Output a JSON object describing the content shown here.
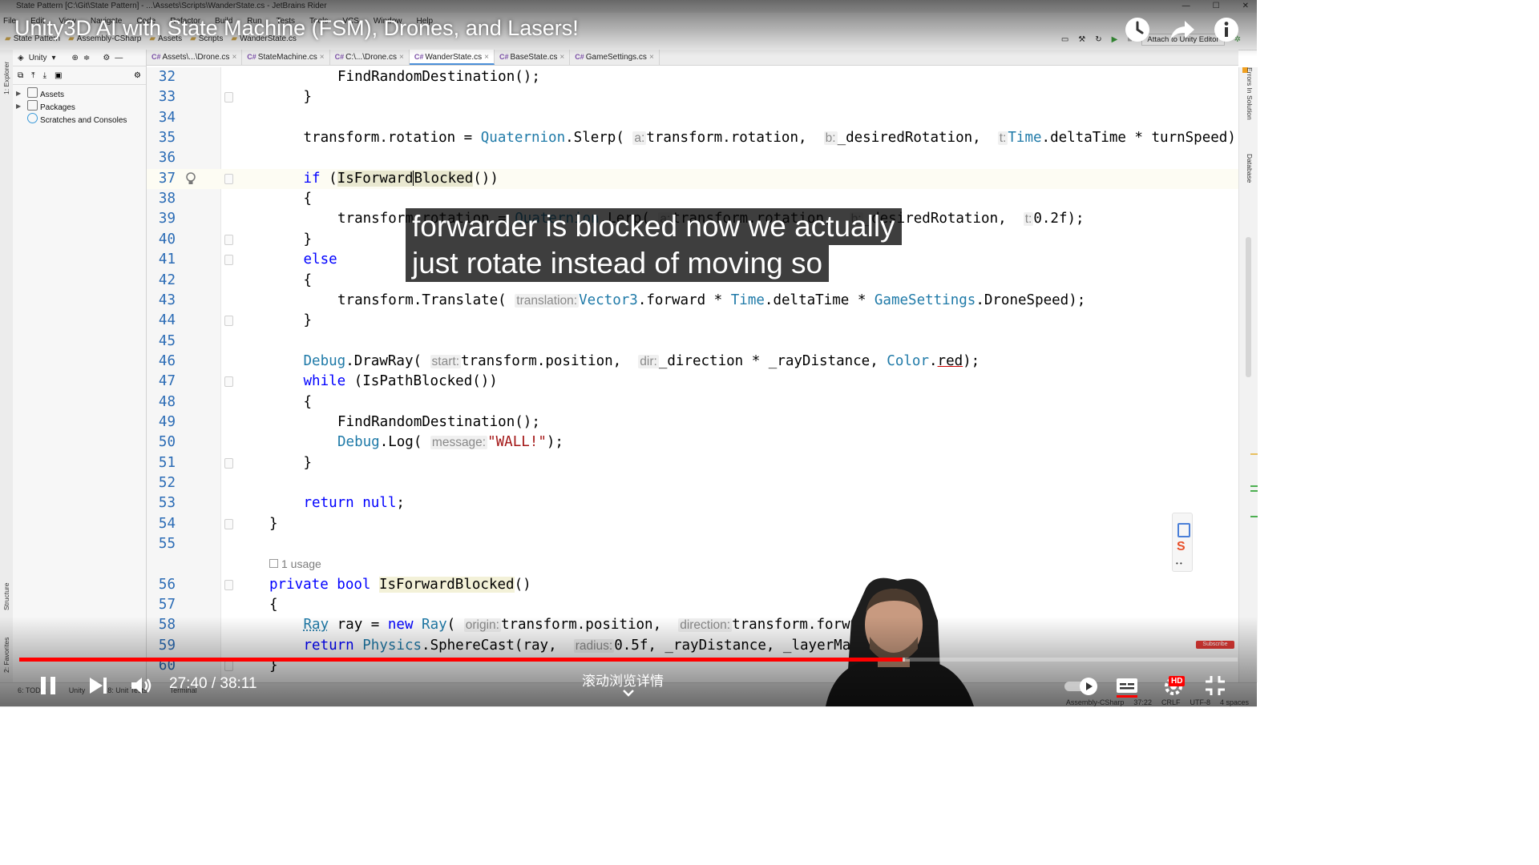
{
  "window": {
    "title": "State Pattern [C:\\Git\\State Pattern] - ...\\Assets\\Scripts\\WanderState.cs - JetBrains Rider"
  },
  "menu": [
    "File",
    "Edit",
    "View",
    "Navigate",
    "Code",
    "Refactor",
    "Build",
    "Run",
    "Tests",
    "Tools",
    "VCS",
    "Window",
    "Help"
  ],
  "breadcrumbs": [
    "State Pattern",
    "Assembly-CSharp",
    "Assets",
    "Scripts",
    "WanderState.cs"
  ],
  "toolbar": {
    "attach_label": "Attach to Unity Editor"
  },
  "explorer": {
    "dropdown": "Unity",
    "items": [
      "Assets",
      "Packages",
      "Scratches and Consoles"
    ]
  },
  "left_strip": {
    "explorer_label": "1: Explorer",
    "structure_label": "Structure",
    "favorites_label": "2: Favorites"
  },
  "right_strip": {
    "errors_label": "Errors In Solution",
    "database_label": "Database"
  },
  "tabs": [
    {
      "label": "Assets\\...\\Drone.cs"
    },
    {
      "label": "StateMachine.cs"
    },
    {
      "label": "C:\\...\\Drone.cs"
    },
    {
      "label": "WanderState.cs",
      "active": true
    },
    {
      "label": "BaseState.cs"
    },
    {
      "label": "GameSettings.cs"
    }
  ],
  "editor": {
    "line_numbers": [
      "32",
      "33",
      "34",
      "35",
      "36",
      "37",
      "38",
      "39",
      "40",
      "41",
      "42",
      "43",
      "44",
      "45",
      "46",
      "47",
      "48",
      "49",
      "50",
      "51",
      "52",
      "53",
      "54",
      "55",
      "56",
      "57",
      "58",
      "59",
      "60"
    ],
    "usage_label": "1 usage",
    "hints": {
      "a": "a:",
      "b": "b:",
      "t": "t:",
      "translation": "translation:",
      "start": "start:",
      "dir": "dir:",
      "message": "message:",
      "origin": "origin:",
      "direction": "direction:",
      "radius": "radius:"
    }
  },
  "statusbar": {
    "left_items": [
      "6: TODO",
      "Unity",
      "8: Unit Tests",
      "Terminal"
    ],
    "right_items": [
      "Assembly-CSharp",
      "37:22",
      "CRLF",
      "UTF-8",
      "4 spaces"
    ]
  },
  "video": {
    "title": "Unity3D AI with State Machine (FSM), Drones, and Lasers!",
    "caption_line1": "forwarder is blocked now we actually",
    "caption_line2": "just rotate instead of moving so",
    "current_time": "27:40",
    "duration": "38:11",
    "timecode": "27:40 / 38:11",
    "scroll_hint": "滚动浏览详情",
    "progress_played": 0.725,
    "progress_loaded": 0.727,
    "quality_badge": "HD",
    "subscribe_label": "Subscribe",
    "accent_color": "#ff0000"
  }
}
